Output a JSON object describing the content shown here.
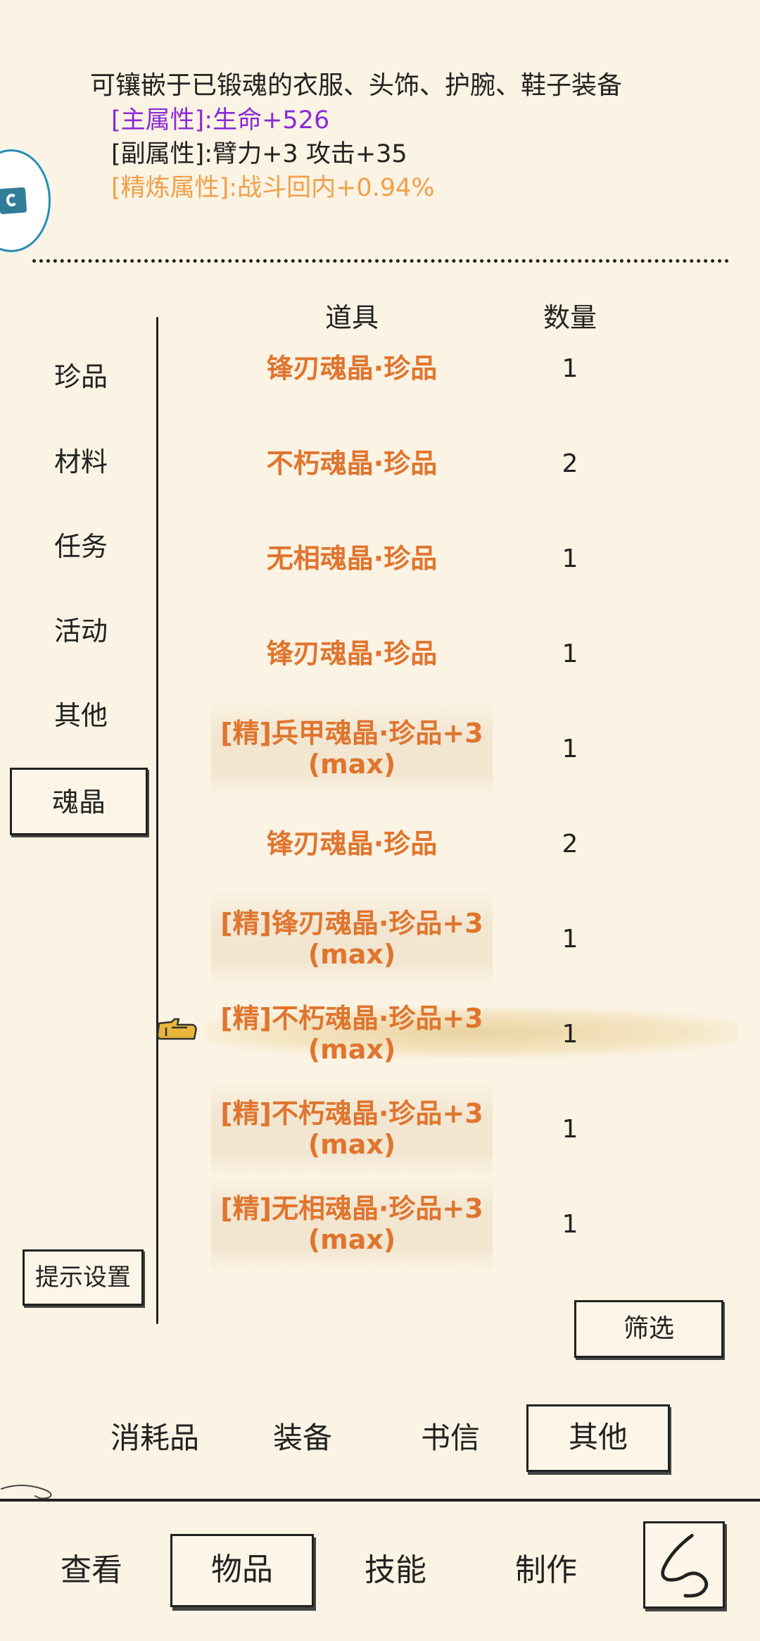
{
  "description": {
    "title": "可镶嵌于已锻魂的衣服、头饰、护腕、鞋子装备",
    "main_attr": "[主属性]:生命+526",
    "sub_attr": "[副属性]:臂力+3 攻击+35",
    "refine_attr": "[精炼属性]:战斗回内+0.94%"
  },
  "categories": [
    {
      "label": "珍品"
    },
    {
      "label": "材料"
    },
    {
      "label": "任务"
    },
    {
      "label": "活动"
    },
    {
      "label": "其他"
    },
    {
      "label": "魂晶",
      "active": true
    }
  ],
  "table": {
    "col_item": "道具",
    "col_qty": "数量",
    "rows": [
      {
        "line1": "锋刃魂晶·珍品",
        "line2": "",
        "qty": "1"
      },
      {
        "line1": "不朽魂晶·珍品",
        "line2": "",
        "qty": "2"
      },
      {
        "line1": "无相魂晶·珍品",
        "line2": "",
        "qty": "1"
      },
      {
        "line1": "锋刃魂晶·珍品",
        "line2": "",
        "qty": "1"
      },
      {
        "line1": "[精]兵甲魂晶·珍品+3",
        "line2": "(max)",
        "qty": "1"
      },
      {
        "line1": "锋刃魂晶·珍品",
        "line2": "",
        "qty": "2"
      },
      {
        "line1": "[精]锋刃魂晶·珍品+3",
        "line2": "(max)",
        "qty": "1"
      },
      {
        "line1": "[精]不朽魂晶·珍品+3",
        "line2": "(max)",
        "qty": "1"
      },
      {
        "line1": "[精]不朽魂晶·珍品+3",
        "line2": "(max)",
        "qty": "1"
      },
      {
        "line1": "[精]无相魂晶·珍品+3",
        "line2": "(max)",
        "qty": "1"
      }
    ]
  },
  "hint_settings_label": "提示设置",
  "filter_label": "筛选",
  "sub_tabs": [
    {
      "label": "消耗品"
    },
    {
      "label": "装备"
    },
    {
      "label": "书信"
    },
    {
      "label": "其他",
      "active": true
    }
  ],
  "bottom_nav": [
    {
      "label": "查看"
    },
    {
      "label": "物品",
      "active": true
    },
    {
      "label": "技能"
    },
    {
      "label": "制作"
    }
  ],
  "icons": {
    "badge": "floating-app-badge-icon",
    "pointer": "hand-pointer-icon",
    "back": "back-arrow-icon"
  },
  "colors": {
    "background": "#fbf3e3",
    "main_attr": "#8a2bd6",
    "refine_attr": "#f0a04a",
    "item_name": "#e0752f",
    "text": "#222222"
  }
}
